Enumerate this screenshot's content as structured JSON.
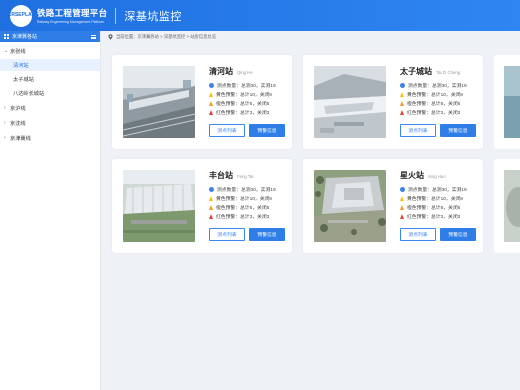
{
  "header": {
    "logo_text": "CRSEPLAT",
    "brand_cn": "铁路工程管理平台",
    "brand_en": "Railway Engineering Management Platform",
    "module_title": "深基坑监控"
  },
  "sidebar": {
    "title": "京津冀各站",
    "lines": [
      {
        "label": "京张线",
        "open": true,
        "stations": [
          "清河站",
          "太子城站",
          "八达岭长城站"
        ]
      },
      {
        "label": "京沪线",
        "open": false,
        "stations": []
      },
      {
        "label": "京沈线",
        "open": false,
        "stations": []
      },
      {
        "label": "京津冀线",
        "open": false,
        "stations": []
      }
    ]
  },
  "breadcrumb": "当前位置：京津冀各站 > 深基坑监控 > 站房信息总览",
  "stat_labels": {
    "points": "测点数量：总测30，实测19",
    "yellow": "黄色预警：总计10，关闭8",
    "orange": "橙色预警：总计6，关闭5",
    "red": "红色预警：总计3，关闭3"
  },
  "colors": {
    "blue": "#3b82e8",
    "yellow": "#f3c21c",
    "orange": "#f59a23",
    "red": "#e0443a",
    "accent": "#2f7de6"
  },
  "buttons": {
    "points_list": "测点列表",
    "alert_info": "预警信息"
  },
  "cards": [
    {
      "name": "清河站",
      "pinyin": "Qing He"
    },
    {
      "name": "太子城站",
      "pinyin": "Tai Zi Cheng"
    },
    {
      "name": "丰台站",
      "pinyin": "Feng Tai"
    },
    {
      "name": "星火站",
      "pinyin": "Xing Huo"
    }
  ]
}
